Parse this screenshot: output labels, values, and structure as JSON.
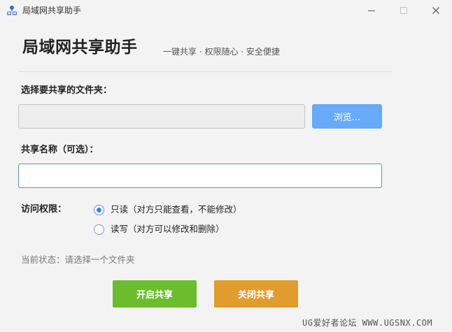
{
  "window": {
    "title": "局域网共享助手",
    "icon": "network-share-icon",
    "controls": [
      "minimize",
      "maximize",
      "close"
    ]
  },
  "header": {
    "heading": "局域网共享助手",
    "slogan": "一键共享 · 权限随心 · 安全便捷"
  },
  "folder": {
    "label": "选择要共享的文件夹：",
    "value": "",
    "browse_label": "浏览..."
  },
  "share_name": {
    "label": "共享名称（可选）：",
    "value": ""
  },
  "access": {
    "label": "访问权限：",
    "options": [
      {
        "label": "只读（对方只能查看，不能修改）",
        "selected": true
      },
      {
        "label": "读写（对方可以修改和删除）",
        "selected": false
      }
    ]
  },
  "status": {
    "text": "当前状态：请选择一个文件夹"
  },
  "actions": {
    "start_label": "开启共享",
    "stop_label": "关闭共享"
  },
  "watermark": "UG爱好者论坛 WWW.UGSNX.COM",
  "colors": {
    "browse": "#66aaf8",
    "start": "#6cbd2d",
    "stop": "#e09c2c",
    "radio_accent": "#3b82e0",
    "focus_border": "#5a8fd4"
  }
}
